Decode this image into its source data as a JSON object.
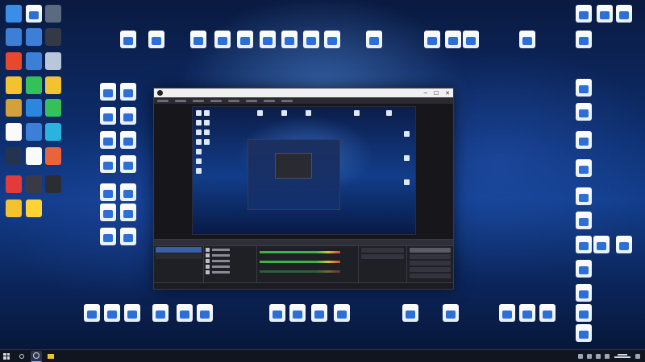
{
  "theme": {
    "accent": "#3b5ea8",
    "obs_bg": "#1f1f26",
    "taskbar_bg": "#101520",
    "meter_green": "#39b54a",
    "meter_red": "#d9443a"
  },
  "desktop": {
    "icons": [
      {
        "kind": "app",
        "icon": "pc-icon",
        "color": "#3a8ee6"
      },
      {
        "kind": "doc",
        "icon": "document-icon",
        "color": "#ffffff"
      },
      {
        "kind": "app",
        "icon": "studio-app-icon",
        "color": "#5a6a80"
      },
      {
        "kind": "app",
        "icon": "network-icon",
        "color": "#3b7fd6"
      },
      {
        "kind": "app",
        "icon": "monitor-icon",
        "color": "#3b7fd6"
      },
      {
        "kind": "app",
        "icon": "zipper-app-icon",
        "color": "#333a46"
      },
      {
        "kind": "app",
        "icon": "office-app-icon",
        "color": "#e8492b"
      },
      {
        "kind": "app",
        "icon": "control-panel-icon",
        "color": "#3b7fd6"
      },
      {
        "kind": "app",
        "icon": "recycle-bin-icon",
        "color": "#b9c7da"
      },
      {
        "kind": "app",
        "icon": "media-player-icon",
        "color": "#f2c230"
      },
      {
        "kind": "app",
        "icon": "wechat-icon",
        "color": "#35c15a"
      },
      {
        "kind": "app",
        "icon": "game-app-icon",
        "color": "#f2c230"
      },
      {
        "kind": "app",
        "icon": "game-launcher-icon",
        "color": "#d2a13a"
      },
      {
        "kind": "app",
        "icon": "browser-icon",
        "color": "#2b86e0"
      },
      {
        "kind": "app",
        "icon": "iqiyi-icon",
        "color": "#35c15a"
      },
      {
        "kind": "app",
        "icon": "qq-icon",
        "color": "#fafafa"
      },
      {
        "kind": "app",
        "icon": "star-app-icon",
        "color": "#3b7fd6"
      },
      {
        "kind": "app",
        "icon": "edge-browser-icon",
        "color": "#2bb3e0"
      },
      {
        "kind": "app",
        "icon": "steam-icon",
        "color": "#24344e"
      },
      {
        "kind": "app",
        "icon": "qq-icon",
        "color": "#fafafa"
      },
      {
        "kind": "app",
        "icon": "game-app-icon",
        "color": "#e8643a"
      },
      {
        "kind": "app",
        "icon": "netease-music-icon",
        "color": "#e33a3a"
      },
      {
        "kind": "app",
        "icon": "obs-studio-icon",
        "color": "#3a3a46"
      },
      {
        "kind": "app",
        "icon": "video-editor-icon",
        "color": "#2c2c34"
      },
      {
        "kind": "app",
        "icon": "g-app-icon",
        "color": "#f2c230"
      },
      {
        "kind": "app",
        "icon": "cs-app-icon",
        "color": "#ffd335"
      }
    ]
  },
  "obs": {
    "window_title": "",
    "status_text": ""
  },
  "taskbar": {
    "clock_time": "",
    "clock_date": ""
  }
}
